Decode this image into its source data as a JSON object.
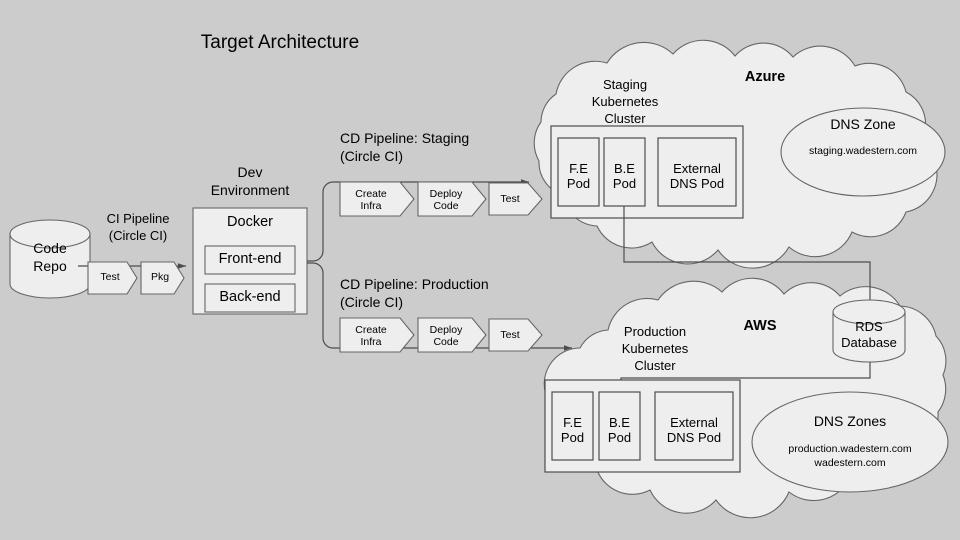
{
  "diagram": {
    "title": "Target Architecture",
    "background_color": "#cccccc",
    "shape_fill": "#eeeeee",
    "stroke_color": "#666666",
    "dark_stroke_color": "#4d4d4d"
  },
  "source": {
    "repo": {
      "label_line1": "Code",
      "label_line2": "Repo",
      "shape": "cylinder"
    }
  },
  "ci_pipeline": {
    "label_line1": "CI Pipeline",
    "label_line2": "(Circle CI)",
    "steps": [
      {
        "label": "Test"
      },
      {
        "label": "Pkg"
      }
    ]
  },
  "dev_environment": {
    "title_line1": "Dev",
    "title_line2": "Environment",
    "container_label": "Docker",
    "components": [
      {
        "label": "Front-end"
      },
      {
        "label": "Back-end"
      }
    ]
  },
  "cd_pipelines": [
    {
      "id": "staging",
      "label_line1": "CD Pipeline: Staging",
      "label_line2": "(Circle CI)",
      "steps": [
        {
          "label_line1": "Create",
          "label_line2": "Infra"
        },
        {
          "label_line1": "Deploy",
          "label_line2": "Code"
        },
        {
          "label_line1": "Test",
          "label_line2": ""
        }
      ]
    },
    {
      "id": "production",
      "label_line1": "CD Pipeline: Production",
      "label_line2": "(Circle CI)",
      "steps": [
        {
          "label_line1": "Create",
          "label_line2": "Infra"
        },
        {
          "label_line1": "Deploy",
          "label_line2": "Code"
        },
        {
          "label_line1": "Test",
          "label_line2": ""
        }
      ]
    }
  ],
  "clouds": [
    {
      "id": "azure",
      "name": "Azure",
      "cluster": {
        "title_line1": "Staging",
        "title_line2": "Kubernetes",
        "title_line3": "Cluster",
        "pods": [
          {
            "label_line1": "F.E",
            "label_line2": "Pod"
          },
          {
            "label_line1": "B.E",
            "label_line2": "Pod"
          },
          {
            "label_line1": "External",
            "label_line2": "DNS Pod"
          }
        ]
      },
      "dns": {
        "title": "DNS Zone",
        "entries": [
          "staging.wadestern.com"
        ]
      }
    },
    {
      "id": "aws",
      "name": "AWS",
      "cluster": {
        "title_line1": "Production",
        "title_line2": "Kubernetes",
        "title_line3": "Cluster",
        "pods": [
          {
            "label_line1": "F.E",
            "label_line2": "Pod"
          },
          {
            "label_line1": "B.E",
            "label_line2": "Pod"
          },
          {
            "label_line1": "External",
            "label_line2": "DNS Pod"
          }
        ]
      },
      "database": {
        "label_line1": "RDS",
        "label_line2": "Database",
        "shape": "cylinder"
      },
      "dns": {
        "title": "DNS Zones",
        "entries": [
          "production.wadestern.com",
          "wadestern.com"
        ]
      }
    }
  ]
}
